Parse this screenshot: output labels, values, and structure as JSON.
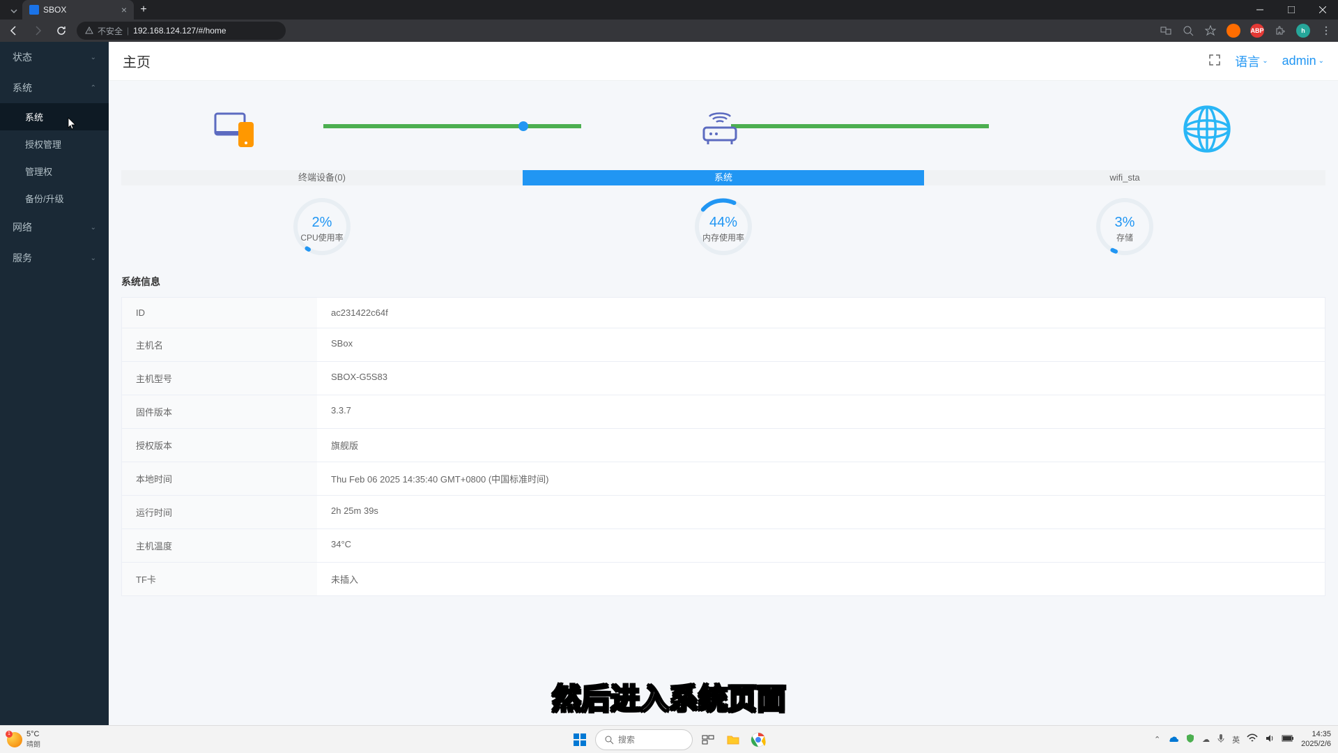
{
  "browser": {
    "tab_title": "SBOX",
    "insecure_label": "不安全",
    "url": "192.168.124.127/#/home"
  },
  "sidebar": {
    "items": [
      {
        "label": "状态",
        "expanded": false
      },
      {
        "label": "系统",
        "expanded": true,
        "subs": [
          {
            "label": "系统",
            "active": true
          },
          {
            "label": "授权管理"
          },
          {
            "label": "管理权"
          },
          {
            "label": "备份/升级"
          }
        ]
      },
      {
        "label": "网络",
        "expanded": false
      },
      {
        "label": "服务",
        "expanded": false
      }
    ]
  },
  "header": {
    "title": "主页",
    "language": "语言",
    "user": "admin"
  },
  "topology": {
    "nodes": [
      {
        "id": "terminal",
        "label": "终端设备(0)"
      },
      {
        "id": "system",
        "label": "系统",
        "active": true
      },
      {
        "id": "wifi",
        "label": "wifi_sta"
      }
    ]
  },
  "gauges": [
    {
      "pct": "2%",
      "label": "CPU使用率",
      "value": 2
    },
    {
      "pct": "44%",
      "label": "内存使用率",
      "value": 44
    },
    {
      "pct": "3%",
      "label": "存储",
      "value": 3
    }
  ],
  "info": {
    "section_title": "系统信息",
    "rows": [
      {
        "key": "ID",
        "val": "ac231422c64f"
      },
      {
        "key": "主机名",
        "val": "SBox"
      },
      {
        "key": "主机型号",
        "val": "SBOX-G5S83"
      },
      {
        "key": "固件版本",
        "val": "3.3.7"
      },
      {
        "key": "授权版本",
        "val": "旗舰版"
      },
      {
        "key": "本地时间",
        "val": "Thu Feb 06 2025 14:35:40 GMT+0800 (中国标准时间)"
      },
      {
        "key": "运行时间",
        "val": "2h 25m 39s"
      },
      {
        "key": "主机温度",
        "val": "34°C"
      },
      {
        "key": "TF卡",
        "val": "未插入"
      }
    ]
  },
  "subtitle": "然后进入系统页面",
  "taskbar": {
    "weather_temp": "5°C",
    "weather_desc": "晴朗",
    "search_placeholder": "搜索",
    "ime": "英",
    "time": "14:35",
    "date": "2025/2/6"
  }
}
